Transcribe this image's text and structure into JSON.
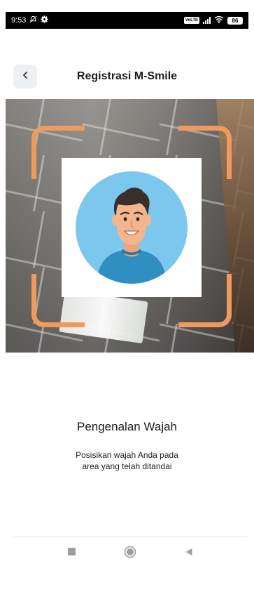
{
  "status_bar": {
    "time": "9:53",
    "volte_badge": "VoLTE",
    "battery": "86"
  },
  "header": {
    "title": "Registrasi M-Smile"
  },
  "face_registration": {
    "title": "Pengenalan Wajah",
    "description_line1": "Posisikan wajah Anda pada",
    "description_line2": "area yang telah ditandai"
  },
  "colors": {
    "frame_accent": "#f09a5e",
    "avatar_bg": "#7cc7ee",
    "shirt": "#2f8fc0",
    "hair": "#3a2e2a",
    "skin": "#f3b58c"
  },
  "icons": {
    "back": "chevron-left-icon",
    "mute": "mute-bell-icon",
    "settings": "gear-icon",
    "signal": "signal-icon",
    "wifi": "wifi-icon",
    "battery": "battery-icon",
    "nav_recent": "square-icon",
    "nav_home": "circle-icon",
    "nav_back": "triangle-icon"
  }
}
